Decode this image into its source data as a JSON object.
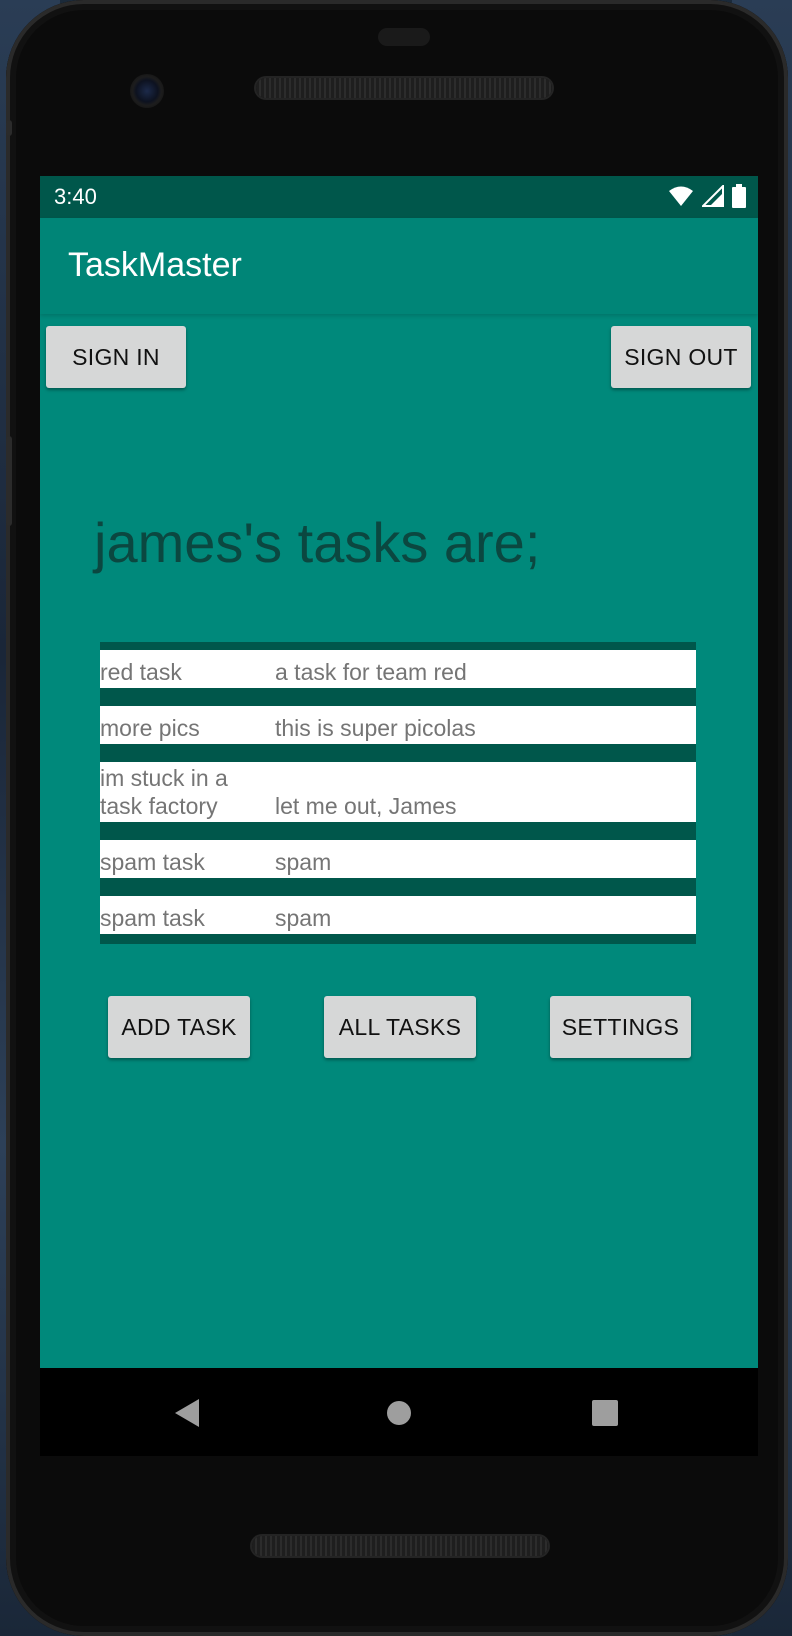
{
  "status_bar": {
    "time": "3:40",
    "icons": [
      "wifi-icon",
      "signal-icon",
      "battery-icon"
    ]
  },
  "app_bar": {
    "title": "TaskMaster"
  },
  "auth": {
    "sign_in_label": "SIGN IN",
    "sign_out_label": "SIGN OUT"
  },
  "heading": "james's tasks are;",
  "tasks": [
    {
      "title": "red task",
      "body": "a task for team red"
    },
    {
      "title": "more pics",
      "body": "this is super picolas"
    },
    {
      "title": "im stuck in a task factory",
      "body": "let me out,  James"
    },
    {
      "title": "spam task",
      "body": "spam"
    },
    {
      "title": "spam task",
      "body": "spam"
    }
  ],
  "actions": {
    "add_task_label": "ADD TASK",
    "all_tasks_label": "ALL TASKS",
    "settings_label": "SETTINGS"
  },
  "nav": {
    "icons": [
      "back-icon",
      "home-icon",
      "recents-icon"
    ]
  },
  "colors": {
    "primary": "#008577",
    "primary_dark": "#00574b",
    "screen_bg": "#00897b",
    "heading_text": "#0b4740"
  }
}
